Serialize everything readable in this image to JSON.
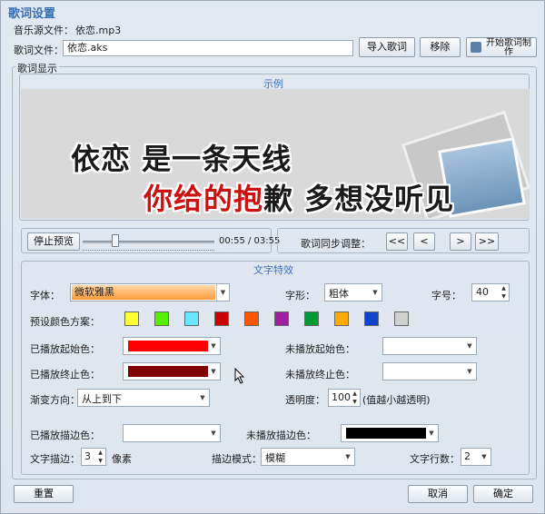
{
  "window": {
    "title": "歌词设置"
  },
  "source": {
    "label": "音乐源文件：",
    "file": "依恋.mp3"
  },
  "lyricfile": {
    "label": "歌词文件：",
    "value": "依恋.aks",
    "import": "导入歌词",
    "remove": "移除",
    "start_make": "开始歌词制作"
  },
  "lyric_display": {
    "title": "歌词显示",
    "example_title": "示例",
    "line1": "依恋 是一条天线",
    "line2_highlight": "你给的抱",
    "line2_rest": "歉 多想没听见",
    "stop_preview": "停止预览",
    "time": "00:55 / 03:55",
    "progress": 0.245,
    "sync_label": "歌词同步调整：",
    "sync_buttons": [
      "<<",
      "<",
      ">",
      ">>"
    ]
  },
  "effects": {
    "title": "文字特效",
    "font_label": "字体：",
    "font_value": "微软雅黑",
    "style_label": "字形：",
    "style_value": "粗体",
    "size_label": "字号：",
    "size_value": "40",
    "preset_label": "预设颜色方案：",
    "presets": [
      "#ffff33",
      "#55ee00",
      "#66e6ff",
      "#cc0000",
      "#ff5500",
      "#a020a0",
      "#009933",
      "#ffaa00",
      "#1144cc",
      "#d0d0d0"
    ],
    "played_start_label": "已播放起始色：",
    "played_start_color": "#ff0000",
    "unplayed_start_label": "未播放起始色：",
    "unplayed_start_color": "#ffffff",
    "played_end_label": "已播放终止色：",
    "played_end_color": "#800000",
    "unplayed_end_label": "未播放终止色：",
    "unplayed_end_color": "#ffffff",
    "gradient_label": "渐变方向：",
    "gradient_value": "从上到下",
    "opacity_label": "透明度：",
    "opacity_value": "100",
    "opacity_hint": "(值越小越透明)",
    "played_stroke_label": "已播放描边色：",
    "played_stroke_color": "#ffffff",
    "unplayed_stroke_label": "未播放描边色：",
    "unplayed_stroke_color": "#000000",
    "stroke_label": "文字描边：",
    "stroke_value": "3",
    "stroke_unit": "像素",
    "stroke_mode_label": "描边模式：",
    "stroke_mode_value": "模糊",
    "lines_label": "文字行数：",
    "lines_value": "2"
  },
  "footer": {
    "reset": "重置",
    "cancel": "取消",
    "ok": "确定"
  }
}
